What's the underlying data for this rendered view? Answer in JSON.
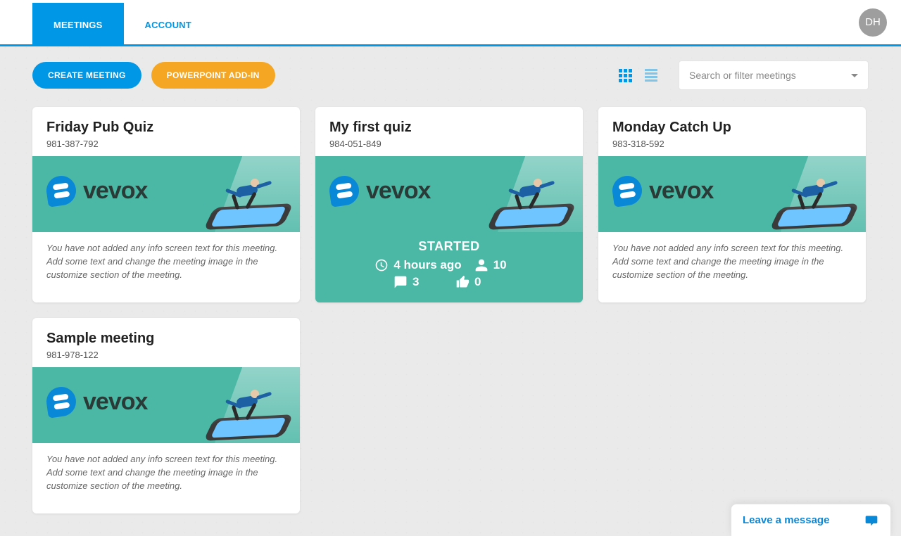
{
  "tabs": {
    "meetings": "MEETINGS",
    "account": "ACCOUNT"
  },
  "avatar_initials": "DH",
  "toolbar": {
    "create": "CREATE MEETING",
    "addin": "POWERPOINT ADD-IN"
  },
  "filter": {
    "placeholder": "Search or filter meetings"
  },
  "brand_logo_text": "vevox",
  "default_info_text": "You have not added any info screen text for this meeting. Add some text and change the meeting image in the customize section of the meeting.",
  "cards": [
    {
      "title": "Friday Pub Quiz",
      "id": "981-387-792",
      "started": false
    },
    {
      "title": "My first quiz",
      "id": "984-051-849",
      "started": true,
      "status_label": "STARTED",
      "time_ago": "4 hours ago",
      "participants": "10",
      "messages": "3",
      "likes": "0"
    },
    {
      "title": "Monday Catch Up",
      "id": "983-318-592",
      "started": false
    },
    {
      "title": "Sample meeting",
      "id": "981-978-122",
      "started": false
    }
  ],
  "chat": {
    "label": "Leave a message"
  }
}
